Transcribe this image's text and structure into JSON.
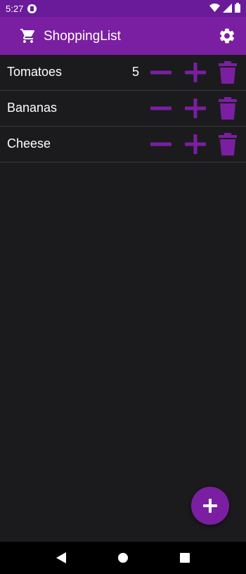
{
  "status_bar": {
    "time": "5:27"
  },
  "app_bar": {
    "title": "ShoppingList"
  },
  "items": [
    {
      "name": "Tomatoes",
      "quantity": "5"
    },
    {
      "name": "Bananas",
      "quantity": ""
    },
    {
      "name": "Cheese",
      "quantity": ""
    }
  ],
  "colors": {
    "primary": "#7b1fa2",
    "status_bar": "#6a1b9a",
    "background": "#1b1b1d",
    "accent_icon": "#7b1fa2"
  },
  "icons": {
    "app_bar": [
      "cart-icon",
      "gear-icon"
    ],
    "row_actions": [
      "minus-icon",
      "plus-icon",
      "trash-icon"
    ],
    "fab": "plus-icon",
    "nav": [
      "back-icon",
      "home-icon",
      "recents-icon"
    ]
  }
}
